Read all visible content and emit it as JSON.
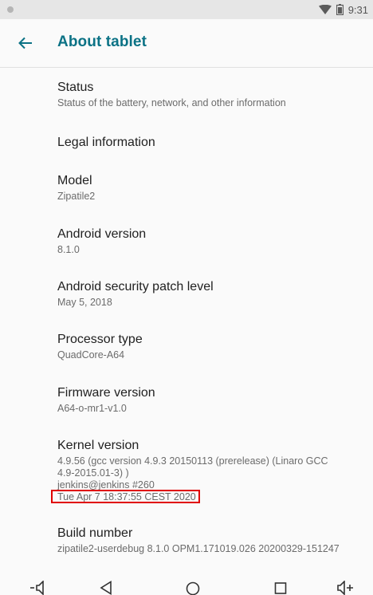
{
  "status_bar": {
    "time": "9:31",
    "icons": [
      "notification-dot",
      "wifi-icon",
      "battery-icon"
    ]
  },
  "app_bar": {
    "title": "About tablet",
    "back_icon": "arrow-left-icon"
  },
  "items": [
    {
      "title": "Status",
      "summary": [
        "Status of the battery, network, and other information"
      ]
    },
    {
      "title": "Legal information",
      "summary": []
    },
    {
      "title": "Model",
      "summary": [
        "Zipatile2"
      ]
    },
    {
      "title": "Android version",
      "summary": [
        "8.1.0"
      ]
    },
    {
      "title": "Android security patch level",
      "summary": [
        "May 5, 2018"
      ]
    },
    {
      "title": "Processor type",
      "summary": [
        "QuadCore-A64"
      ]
    },
    {
      "title": "Firmware version",
      "summary": [
        "A64-o-mr1-v1.0"
      ]
    },
    {
      "title": "Kernel version",
      "summary": [
        "4.9.56 (gcc version 4.9.3 20150113 (prerelease) (Linaro GCC",
        "4.9-2015.01-3) )",
        "jenkins@jenkins #260",
        "Tue Apr 7 18:37:55 CEST 2020"
      ]
    },
    {
      "title": "Build number",
      "summary": [
        "zipatile2-userdebug 8.1.0 OPM1.171019.026 20200329-151247"
      ]
    }
  ],
  "nav_bar": {
    "icons": [
      "volume-down-icon",
      "back-triangle-icon",
      "home-circle-icon",
      "recents-square-icon",
      "volume-up-icon"
    ]
  },
  "colors": {
    "accent": "#0b7285",
    "highlight": "#e00000"
  }
}
